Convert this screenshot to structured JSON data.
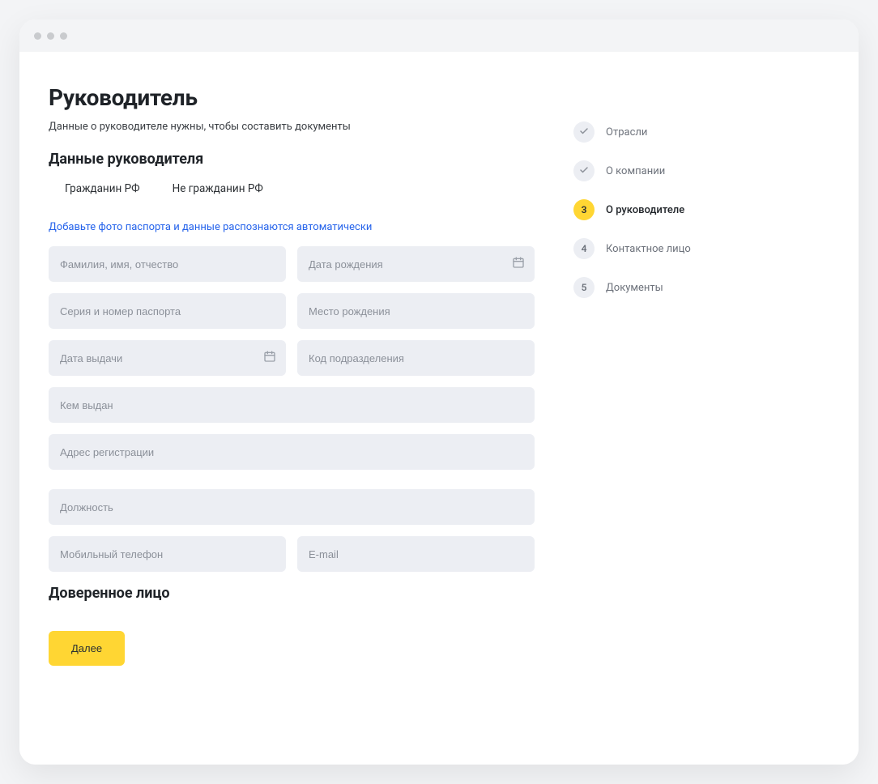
{
  "page": {
    "title": "Руководитель",
    "subtitle": "Данные о руководителе нужны, чтобы составить документы"
  },
  "section": {
    "heading": "Данные руководителя",
    "tabs": {
      "citizen": "Гражданин РФ",
      "non_citizen": "Не гражданин РФ"
    },
    "hint_link": "Добавьте фото паспорта и данные распознаются автоматически"
  },
  "fields": {
    "fio": "Фамилия, имя, отчество",
    "dob": "Дата рождения",
    "passport_sn": "Серия и номер паспорта",
    "pob": "Место рождения",
    "issue_date": "Дата выдачи",
    "dept_code": "Код подразделения",
    "issued_by": "Кем выдан",
    "reg_addr": "Адрес регистрации",
    "position": "Должность",
    "phone": "Мобильный телефон",
    "email": "E-mail"
  },
  "section2": {
    "heading": "Доверенное лицо"
  },
  "buttons": {
    "next": "Далее"
  },
  "steps": {
    "s1": "Отрасли",
    "s2": "О компании",
    "s3_num": "3",
    "s3": "О руководителе",
    "s4_num": "4",
    "s4": "Контактное лицо",
    "s5_num": "5",
    "s5": "Документы"
  }
}
